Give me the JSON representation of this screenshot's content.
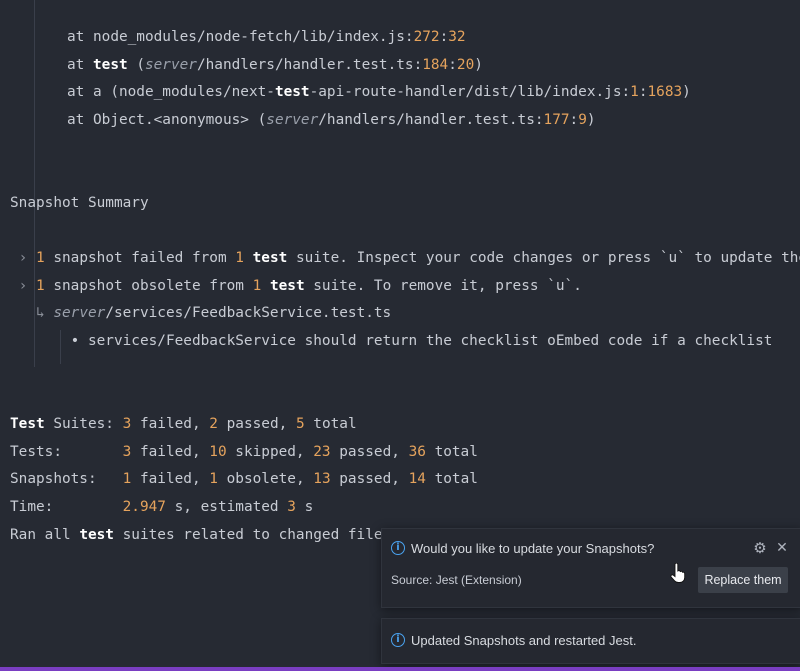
{
  "stack": {
    "l1_at": "at node_modules/node-fetch/lib/index.js:",
    "l1_line": "272",
    "l1_sep": ":",
    "l1_col": "32",
    "l2_at": "at ",
    "l2_fn": "test",
    "l2_open": " (",
    "l2_server": "server",
    "l2_path": "/handlers/handler.test.ts:",
    "l2_line": "184",
    "l2_sep": ":",
    "l2_col": "20",
    "l2_close": ")",
    "l3_a": "at a (node_modules/next-",
    "l3_test": "test",
    "l3_b": "-api-route-handler/dist/lib/index.js:",
    "l3_line": "1",
    "l3_sep": ":",
    "l3_col": "1683",
    "l3_close": ")",
    "l4_at": "at Object.<anonymous> (",
    "l4_server": "server",
    "l4_path": "/handlers/handler.test.ts:",
    "l4_line": "177",
    "l4_sep": ":",
    "l4_col": "9",
    "l4_close": ")"
  },
  "summary": {
    "heading": "Snapshot Summary",
    "f_arrow": " › ",
    "f_count": "1",
    "f_a": " snapshot failed from ",
    "f_suites": "1",
    "f_sp": " ",
    "f_test": "test",
    "f_b": " suite. Inspect your code changes or press `u` to update them.",
    "o_arrow": " › ",
    "o_count": "1",
    "o_a": " snapshot obsolete from ",
    "o_suites": "1",
    "o_sp": " ",
    "o_test": "test",
    "o_b": " suite. To remove it, press `u`.",
    "file_arrow": "   ↳ ",
    "file_server": "server",
    "file_path": "/services/FeedbackService.test.ts",
    "item": "       • services/FeedbackService should return the checklist oEmbed code if a checklist"
  },
  "results": {
    "suites_label": "Test",
    "suites_label2": " Suites: ",
    "suites_failed": "3",
    "suites_failed_t": " failed, ",
    "suites_passed": "2",
    "suites_passed_t": " passed, ",
    "suites_total": "5",
    "suites_total_t": " total",
    "tests_label": "Tests:       ",
    "tests_failed": "3",
    "tests_failed_t": " failed, ",
    "tests_skipped": "10",
    "tests_skipped_t": " skipped, ",
    "tests_passed": "23",
    "tests_passed_t": " passed, ",
    "tests_total": "36",
    "tests_total_t": " total",
    "snaps_label": "Snapshots:   ",
    "snaps_failed": "1",
    "snaps_failed_t": " failed, ",
    "snaps_obsolete": "1",
    "snaps_obsolete_t": " obsolete, ",
    "snaps_passed": "13",
    "snaps_passed_t": " passed, ",
    "snaps_total": "14",
    "snaps_total_t": " total",
    "time_label": "Time:        ",
    "time_val": "2.947",
    "time_a": " s, estimated ",
    "time_est": "3",
    "time_b": " s",
    "ran_a": "Ran all ",
    "ran_test": "test",
    "ran_b": " suites related to changed files."
  },
  "toast_update": {
    "info_glyph": "i",
    "title": "Would you like to update your Snapshots?",
    "source": "Source: Jest (Extension)",
    "gear_glyph": "⚙",
    "close_glyph": "✕",
    "button": "Replace them"
  },
  "toast_done": {
    "info_glyph": "i",
    "title": "Updated Snapshots and restarted Jest."
  },
  "colors": {
    "background": "#262a33",
    "text": "#c8ccd4",
    "number": "#e5a35d",
    "info": "#4aa3f0",
    "bottom_bar": "#7a3ec2"
  }
}
